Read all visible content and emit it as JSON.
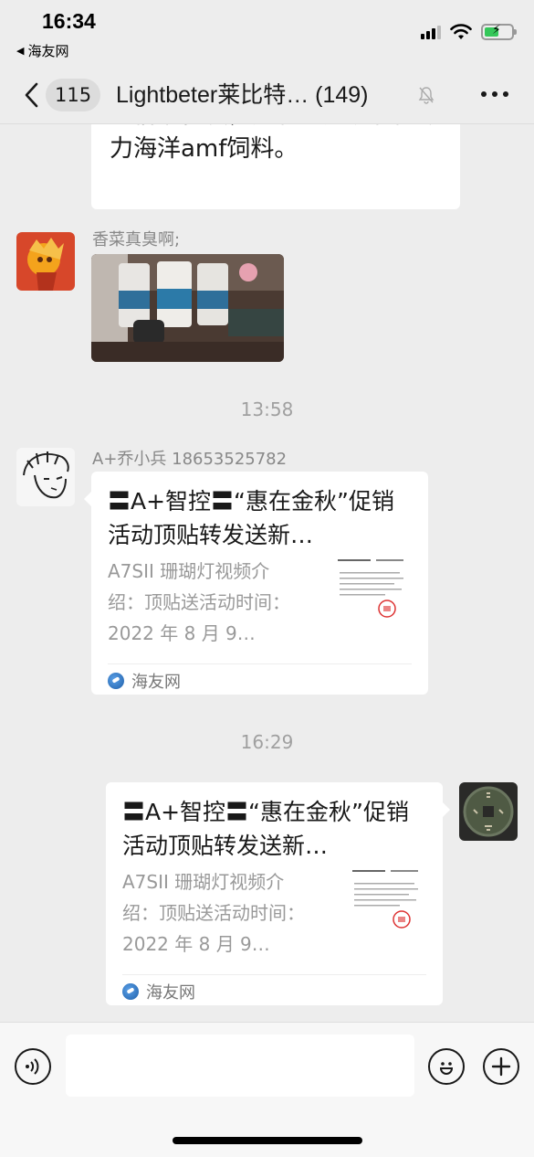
{
  "status_bar": {
    "time": "16:34",
    "back_app": "海友网"
  },
  "nav": {
    "unread_count": "115",
    "title": "Lightbeter莱比特… (149)"
  },
  "messages": {
    "partial_text": "一桶活性炭，还有一瓶混和高够力海洋amf饲料。",
    "photo_sender": "香菜真臭啊;",
    "time1": "13:58",
    "card1": {
      "sender": "A+乔小兵 18653525782",
      "title": "〓A+智控〓“惠在金秋”促销活动顶贴转发送新…",
      "desc": "A7SII 珊瑚灯视频介绍：顶贴送活动时间：2022 年 8 月 9…",
      "source": "海友网"
    },
    "time2": "16:29",
    "card2": {
      "title": "〓A+智控〓“惠在金秋”促销活动顶贴转发送新…",
      "desc": "A7SII 珊瑚灯视频介绍：顶贴送活动时间：2022 年 8 月 9…",
      "source": "海友网"
    }
  },
  "icons": {
    "back": "chevron-left-icon",
    "mute": "bell-slash-icon",
    "more": "more-icon",
    "voice": "voice-icon",
    "emoji": "emoji-icon",
    "plus": "plus-icon"
  },
  "colors": {
    "background": "#ededed",
    "bubble": "#ffffff",
    "battery": "#34c759"
  }
}
